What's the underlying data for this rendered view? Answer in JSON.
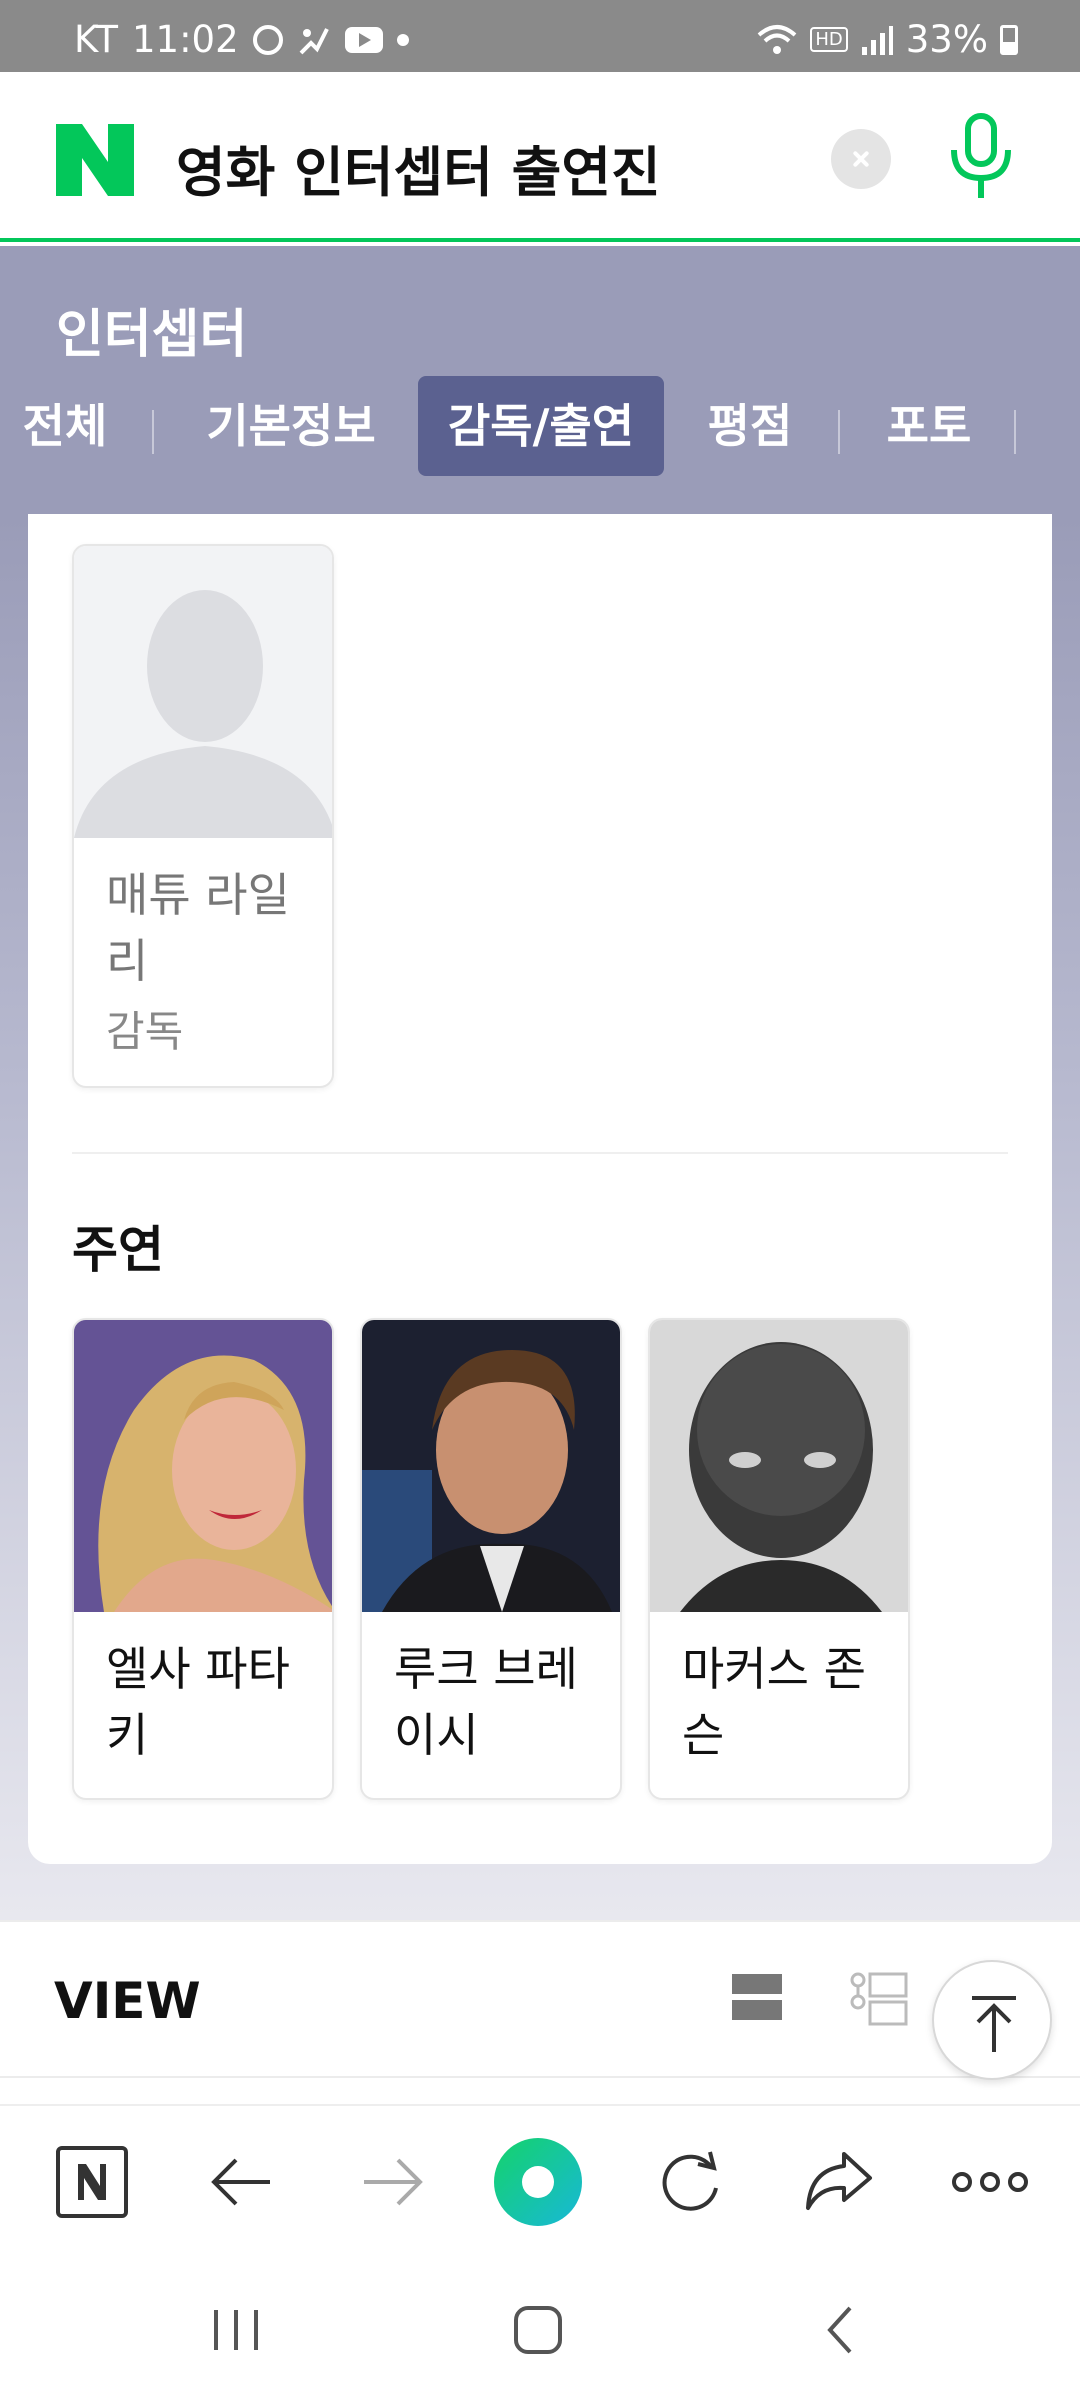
{
  "status_bar": {
    "carrier": "KT",
    "time": "11:02",
    "hd_badge": "HD",
    "battery": "33%",
    "icons": [
      "threads-icon",
      "activity-icon",
      "youtube-icon",
      "notification-dot",
      "wifi-icon",
      "signal-icon",
      "battery-icon"
    ]
  },
  "search": {
    "logo_letter": "N",
    "query": "영화 인터셉터 출연진",
    "clear_icon": "close-icon",
    "mic_icon": "microphone-icon",
    "accent_color": "#03c75a"
  },
  "movie": {
    "title": "인터셉터",
    "tabs": [
      {
        "label": "전체",
        "active": false
      },
      {
        "label": "기본정보",
        "active": false
      },
      {
        "label": "감독/출연",
        "active": true
      },
      {
        "label": "평점",
        "active": false
      },
      {
        "label": "포토",
        "active": false
      }
    ],
    "header_color": "#9a9cb8",
    "active_tab_color": "#5b6190"
  },
  "directors": [
    {
      "name": "매튜 라일리",
      "role": "감독",
      "photo": "placeholder-silhouette"
    }
  ],
  "cast_section": {
    "title": "주연",
    "members": [
      {
        "name": "엘사 파타키",
        "photo": "actress-photo"
      },
      {
        "name": "루크 브레이시",
        "photo": "actor-photo"
      },
      {
        "name": "마커스 존슨",
        "photo": "actor-photo-bw"
      }
    ]
  },
  "view_section": {
    "label": "VIEW",
    "icons": [
      "list-view-icon",
      "detail-view-icon",
      "scroll-top-icon"
    ]
  },
  "browser_toolbar": {
    "icons": [
      "naver-home-icon",
      "back-arrow-icon",
      "forward-arrow-icon",
      "green-dot-button",
      "refresh-icon",
      "share-icon",
      "more-icon"
    ]
  },
  "system_nav": {
    "icons": [
      "recent-apps-icon",
      "home-icon",
      "back-icon"
    ]
  }
}
